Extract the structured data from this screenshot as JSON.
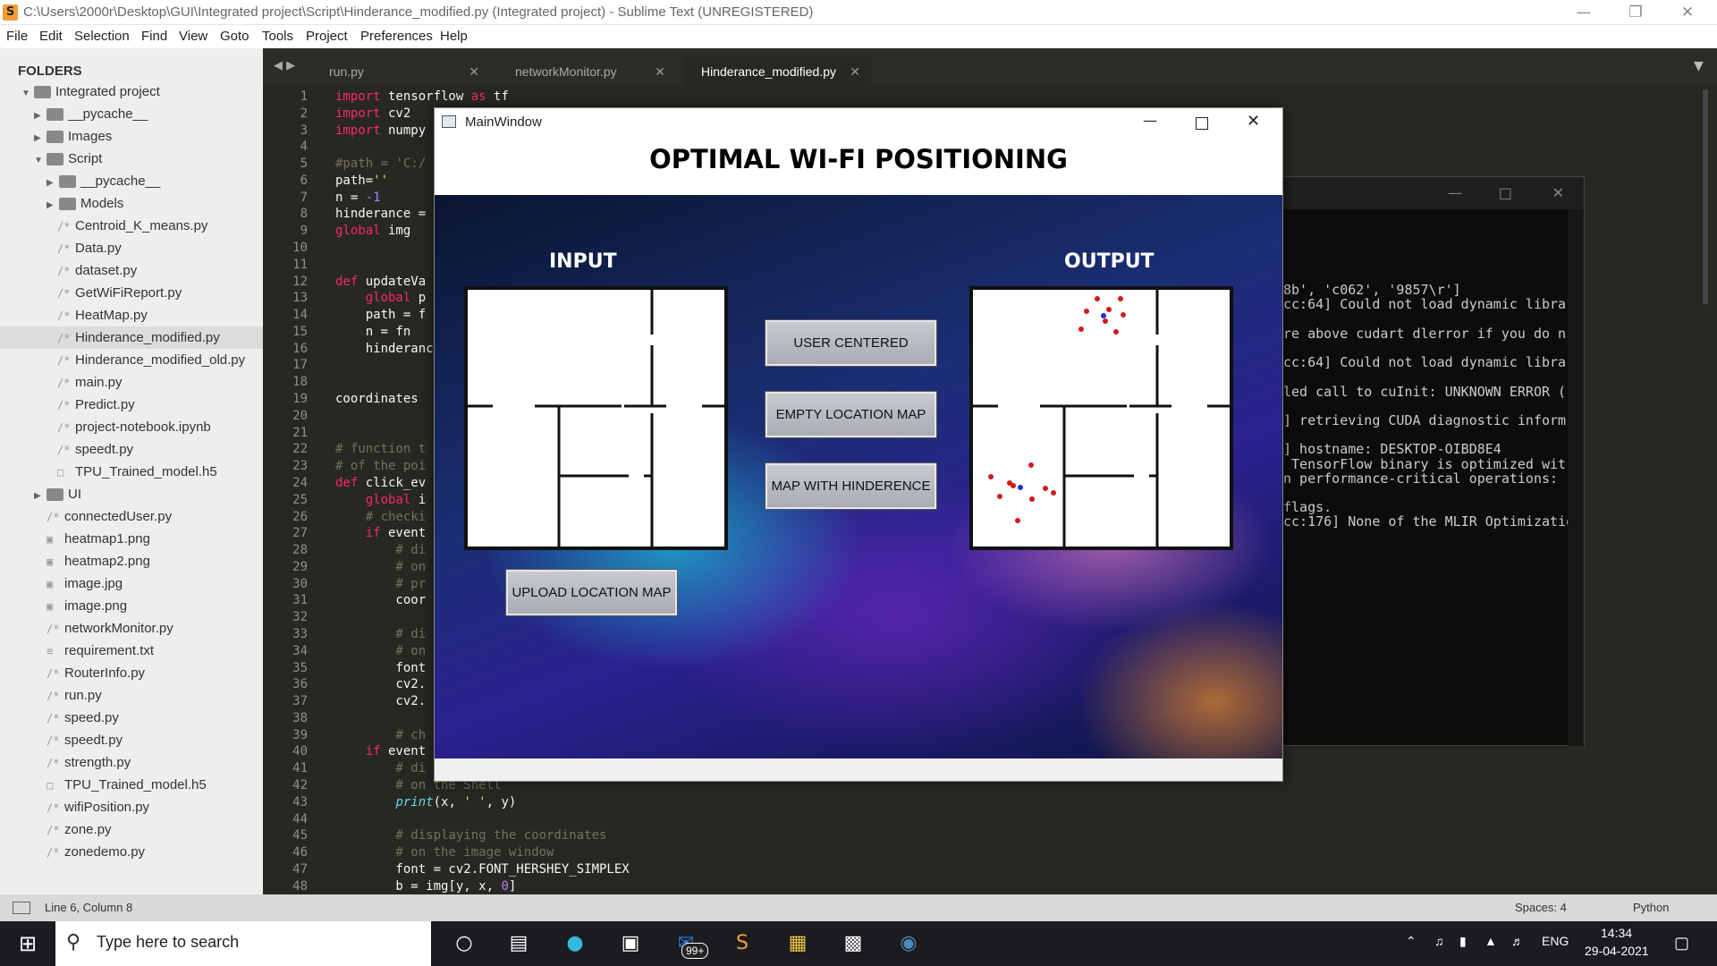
{
  "window": {
    "title": "C:\\Users\\2000r\\Desktop\\GUI\\Integrated project\\Script\\Hinderance_modified.py (Integrated project) - Sublime Text (UNREGISTERED)"
  },
  "menu": [
    "File",
    "Edit",
    "Selection",
    "Find",
    "View",
    "Goto",
    "Tools",
    "Project",
    "Preferences",
    "Help"
  ],
  "sidebar": {
    "header": "FOLDERS",
    "items": [
      {
        "label": "Integrated project",
        "type": "folder-open"
      },
      {
        "label": "__pycache__",
        "type": "folder"
      },
      {
        "label": "Images",
        "type": "folder"
      },
      {
        "label": "Script",
        "type": "folder-open"
      },
      {
        "label": "__pycache__",
        "type": "folder"
      },
      {
        "label": "Models",
        "type": "folder"
      },
      {
        "label": "Centroid_K_means.py",
        "type": "file"
      },
      {
        "label": "Data.py",
        "type": "file"
      },
      {
        "label": "dataset.py",
        "type": "file"
      },
      {
        "label": "GetWiFiReport.py",
        "type": "file"
      },
      {
        "label": "HeatMap.py",
        "type": "file"
      },
      {
        "label": "Hinderance_modified.py",
        "type": "file"
      },
      {
        "label": "Hinderance_modified_old.py",
        "type": "file"
      },
      {
        "label": "main.py",
        "type": "file"
      },
      {
        "label": "Predict.py",
        "type": "file"
      },
      {
        "label": "project-notebook.ipynb",
        "type": "file"
      },
      {
        "label": "speedt.py",
        "type": "file"
      },
      {
        "label": "TPU_Trained_model.h5",
        "type": "doc"
      },
      {
        "label": "UI",
        "type": "folder"
      },
      {
        "label": "connectedUser.py",
        "type": "file"
      },
      {
        "label": "heatmap1.png",
        "type": "image"
      },
      {
        "label": "heatmap2.png",
        "type": "image"
      },
      {
        "label": "image.jpg",
        "type": "image"
      },
      {
        "label": "image.png",
        "type": "image"
      },
      {
        "label": "networkMonitor.py",
        "type": "file"
      },
      {
        "label": "requirement.txt",
        "type": "text"
      },
      {
        "label": "RouterInfo.py",
        "type": "file"
      },
      {
        "label": "run.py",
        "type": "file"
      },
      {
        "label": "speed.py",
        "type": "file"
      },
      {
        "label": "speedt.py",
        "type": "file"
      },
      {
        "label": "strength.py",
        "type": "file"
      },
      {
        "label": "TPU_Trained_model.h5",
        "type": "doc"
      },
      {
        "label": "wifiPosition.py",
        "type": "file"
      },
      {
        "label": "zone.py",
        "type": "file"
      },
      {
        "label": "zonedemo.py",
        "type": "file"
      }
    ],
    "selected": "Hinderance_modified.py"
  },
  "tabs": [
    {
      "label": "run.py",
      "active": false
    },
    {
      "label": "networkMonitor.py",
      "active": false
    },
    {
      "label": "Hinderance_modified.py",
      "active": true
    }
  ],
  "code": [
    "import tensorflow as tf",
    "import cv2",
    "import numpy",
    "",
    "#path = 'C:/",
    "path=''",
    "n = -1",
    "hinderance =",
    "global img",
    "",
    "",
    "def updateVa",
    "    global p",
    "    path = f",
    "    n = fn",
    "    hinderanc",
    "",
    "",
    "coordinates",
    "",
    "",
    "# function t",
    "# of the poi",
    "def click_ev",
    "    global i",
    "    # checki",
    "    if event",
    "        # di",
    "        # on",
    "        # pr",
    "        coor",
    "",
    "        # di",
    "        # on",
    "        font",
    "        cv2.",
    "        cv2.",
    "",
    "        # ch",
    "    if event",
    "        # di",
    "        # on the Shell",
    "        print(x, ' ', y)",
    "",
    "        # displaying the coordinates",
    "        # on the image window",
    "        font = cv2.FONT_HERSHEY_SIMPLEX",
    "        b = img[y, x, 0]"
  ],
  "console": {
    "lines": [
      {
        "row": 6,
        "text": "8b', 'c062', '9857\\r']"
      },
      {
        "row": 7,
        "text": "cc:64] Could not load dynamic libra"
      },
      {
        "row": 9,
        "text": "re above cudart dlerror if you do n"
      },
      {
        "row": 11,
        "text": "cc:64] Could not load dynamic libra"
      },
      {
        "row": 13,
        "text": "led call to cuInit: UNKNOWN ERROR ("
      },
      {
        "row": 15,
        "text": "] retrieving CUDA diagnostic inform"
      },
      {
        "row": 17,
        "text": "] hostname: DESKTOP-OIBD8E4"
      },
      {
        "row": 18,
        "text": " TensorFlow binary is optimized wit"
      },
      {
        "row": 19,
        "text": "n performance-critical operations:"
      },
      {
        "row": 21,
        "text": "flags."
      },
      {
        "row": 22,
        "text": "cc:176] None of the MLIR Optimizatio"
      }
    ]
  },
  "mainwindow": {
    "title": "MainWindow",
    "heading": "OPTIMAL WI-FI POSITIONING",
    "input_label": "INPUT",
    "output_label": "OUTPUT",
    "buttons": {
      "user_centered": "USER CENTERED",
      "empty_location_map": "EMPTY LOCATION MAP",
      "map_with_hinderence": "MAP WITH HINDERENCE",
      "upload_location_map": "UPLOAD LOCATION MAP"
    },
    "colors": {
      "dots": "#d11a1a",
      "router_dot": "#1a2fd1"
    }
  },
  "statusbar": {
    "position": "Line 6, Column 8",
    "spaces": "Spaces: 4",
    "syntax": "Python"
  },
  "taskbar": {
    "search_placeholder": "Type here to search",
    "mail_badge": "99+",
    "language": "ENG",
    "time": "14:34",
    "date": "29-04-2021"
  }
}
